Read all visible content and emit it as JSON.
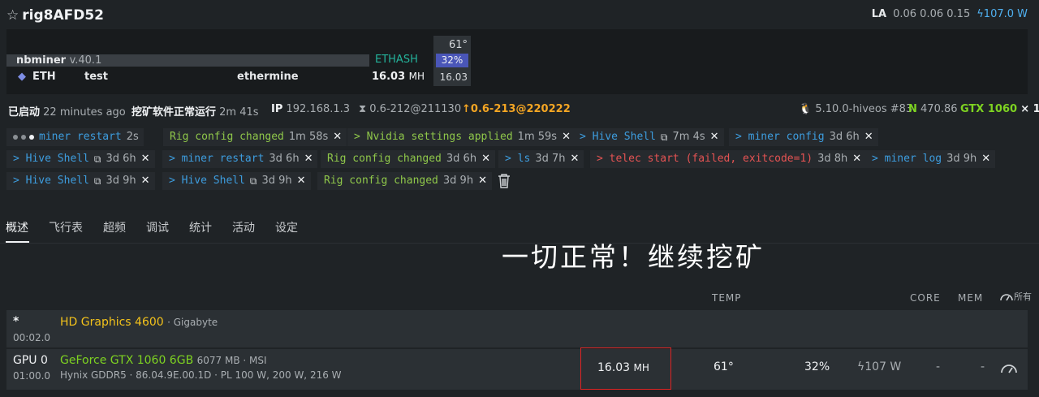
{
  "header": {
    "rig_name": "rig8AFD52",
    "la_label": "LA",
    "la_values": "0.06 0.06 0.15",
    "power": "107.0 W"
  },
  "miner": {
    "name": "nbminer",
    "version": "v.40.1",
    "algo": "ETHASH",
    "coin": "ETH",
    "wallet": "test",
    "pool": "ethermine",
    "hashrate": "16.03",
    "hashrate_unit": "MH",
    "gpu_temp": "61°",
    "gpu_fan": "32%",
    "gpu_hash": "16.03"
  },
  "status": {
    "booted_label": "已启动",
    "booted_value": "22 minutes ago",
    "miner_label": "挖矿软件正常运行",
    "miner_value": "2m 41s",
    "ip_label": "IP",
    "ip_value": "192.168.1.3",
    "version": "0.6-212@211130",
    "update": "0.6-213@220222",
    "kernel": "5.10.0-hiveos #83",
    "nvidia_label": "N",
    "nvidia_value": "470.86",
    "gpu_model": "GTX 1060",
    "gpu_count": "× 1"
  },
  "log": [
    {
      "cmd": "miner restart",
      "time": "2s",
      "color": "blue"
    },
    {
      "cmd": "Rig config changed",
      "time": "1m 58s",
      "color": "green"
    },
    {
      "cmd": "> Nvidia settings applied",
      "time": "1m 59s",
      "color": "green"
    },
    {
      "cmd": "> Hive Shell",
      "time": "7m 4s",
      "color": "blue"
    },
    {
      "cmd": "> miner config",
      "time": "3d 6h",
      "color": "blue"
    },
    {
      "cmd": "> Hive Shell",
      "time": "3d 6h",
      "color": "blue"
    },
    {
      "cmd": "> miner restart",
      "time": "3d 6h",
      "color": "blue"
    },
    {
      "cmd": "Rig config changed",
      "time": "3d 6h",
      "color": "green"
    },
    {
      "cmd": "> ls",
      "time": "3d 7h",
      "color": "blue"
    },
    {
      "cmd": "> telec start (failed, exitcode=1)",
      "time": "3d 8h",
      "color": "red"
    },
    {
      "cmd": "> miner log",
      "time": "3d 9h",
      "color": "blue"
    },
    {
      "cmd": "> Hive Shell",
      "time": "3d 9h",
      "color": "blue"
    },
    {
      "cmd": "> Hive Shell",
      "time": "3d 9h",
      "color": "blue"
    },
    {
      "cmd": "Rig config changed",
      "time": "3d 9h",
      "color": "green"
    }
  ],
  "tabs": [
    "概述",
    "飞行表",
    "超频",
    "调试",
    "统计",
    "活动",
    "设定"
  ],
  "overlay_text": "一切正常！继续挖矿",
  "columns": {
    "temp": "TEMP",
    "core": "CORE",
    "mem": "MEM",
    "all": "所有"
  },
  "devices": [
    {
      "id": "*",
      "bus": "00:02.0",
      "name": "HD Graphics 4600",
      "vendor": "· Gigabyte"
    },
    {
      "id": "GPU 0",
      "bus": "01:00.0",
      "name": "GeForce GTX 1060 6GB",
      "mem": "6077 MB · MSI",
      "details": "Hynix GDDR5 · 86.04.9E.00.1D · PL 100 W, 200 W, 216 W",
      "hashrate": "16.03",
      "hash_unit": "MH",
      "temp": "61°",
      "fan": "32%",
      "power": "107 W",
      "core": "-",
      "mem_oc": "-"
    }
  ],
  "colors": {
    "bg": "#1f2326",
    "accent_blue": "#3d9ddf",
    "accent_green": "#8fc74a",
    "warn": "#f5a623",
    "error": "#e55353"
  }
}
